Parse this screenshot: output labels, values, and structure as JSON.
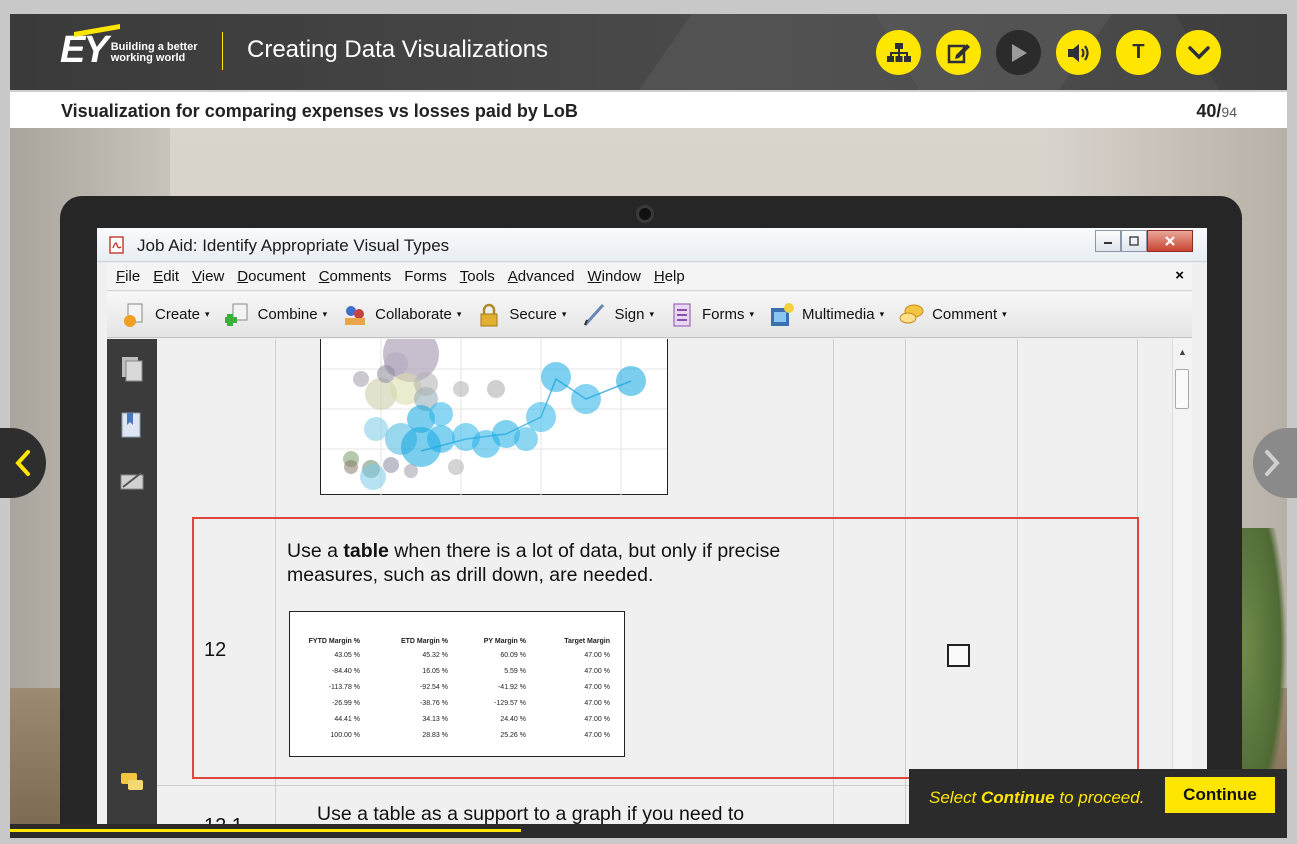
{
  "header": {
    "logo_text": "EY",
    "tagline_line1": "Building a better",
    "tagline_line2": "working world",
    "course_title": "Creating Data Visualizations",
    "buttons": [
      {
        "icon": "sitemap-icon"
      },
      {
        "icon": "notes-edit-icon"
      },
      {
        "icon": "play-icon"
      },
      {
        "icon": "volume-icon"
      },
      {
        "icon": "transcript-icon",
        "label": "T"
      },
      {
        "icon": "chevron-down-icon"
      }
    ]
  },
  "subheader": {
    "title": "Visualization for comparing expenses vs losses paid by LoB",
    "current_page": "40/",
    "total_pages": "94"
  },
  "window": {
    "title": "Job Aid: Identify Appropriate Visual Types",
    "menu": [
      {
        "first": "F",
        "rest": "ile"
      },
      {
        "first": "E",
        "rest": "dit"
      },
      {
        "first": "V",
        "rest": "iew"
      },
      {
        "first": "D",
        "rest": "ocument"
      },
      {
        "first": "C",
        "rest": "omments"
      },
      {
        "first": "Fo",
        "rest": "rms",
        "underline_index": 1
      },
      {
        "first": "T",
        "rest": "ools"
      },
      {
        "first": "A",
        "rest": "dvanced"
      },
      {
        "first": "W",
        "rest": "indow"
      },
      {
        "first": "H",
        "rest": "elp"
      }
    ],
    "menu_close": "×",
    "toolbar": [
      {
        "label": "Create",
        "icon": "create-icon"
      },
      {
        "label": "Combine",
        "icon": "combine-icon"
      },
      {
        "label": "Collaborate",
        "icon": "collaborate-icon"
      },
      {
        "label": "Secure",
        "icon": "lock-icon"
      },
      {
        "label": "Sign",
        "icon": "pen-icon"
      },
      {
        "label": "Forms",
        "icon": "forms-icon"
      },
      {
        "label": "Multimedia",
        "icon": "multimedia-icon"
      },
      {
        "label": "Comment",
        "icon": "comment-icon"
      }
    ],
    "caret": "▾"
  },
  "document": {
    "row12": {
      "number": "12",
      "text_before": "Use a ",
      "text_bold": "table",
      "text_after": " when there is a lot of data, but only if precise measures, such as drill down, are needed.",
      "table": {
        "headers": [
          "FYTD Margin %",
          "ETD Margin %",
          "PY Margin %",
          "Target Margin"
        ],
        "rows": [
          [
            "43.05 %",
            "45.32 %",
            "60.09 %",
            "47.00 %"
          ],
          [
            "-84.40 %",
            "16.05 %",
            "5.59 %",
            "47.00 %"
          ],
          [
            "-113.78 %",
            "-92.54 %",
            "-41.92 %",
            "47.00 %"
          ],
          [
            "-26.99 %",
            "-38.76 %",
            "-129.57 %",
            "47.00 %"
          ],
          [
            "44.41 %",
            "34.13 %",
            "24.40 %",
            "47.00 %"
          ],
          [
            "100.00 %",
            "28.83 %",
            "25.26 %",
            "47.00 %"
          ]
        ]
      }
    },
    "row12_1": {
      "number": "12.1",
      "text": "Use a table as a support to a graph if you need to"
    }
  },
  "proceed": {
    "prefix": "Select ",
    "bold": "Continue",
    "suffix": " to proceed.",
    "button_label": "Continue"
  },
  "progress": {
    "fraction": 0.4
  },
  "colors": {
    "accent": "#ffe600",
    "dark": "#2e2e38",
    "highlight": "#e0463b"
  }
}
